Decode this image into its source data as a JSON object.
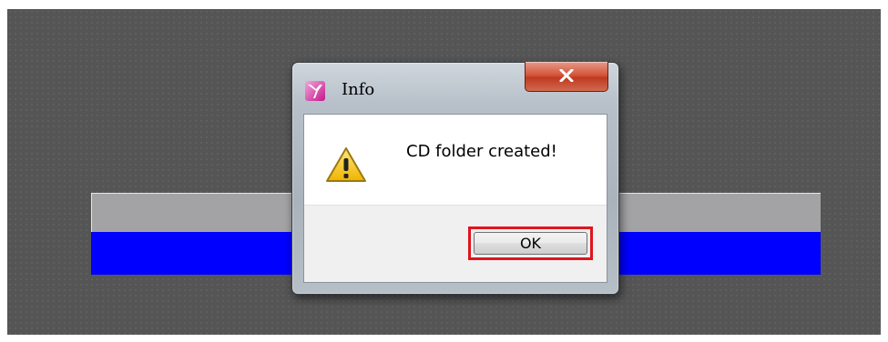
{
  "dialog": {
    "title": "Info",
    "title_icon": "app-logo-icon",
    "close_icon": "close-icon",
    "message_icon": "warning-icon",
    "message": "CD folder created!",
    "ok_label": "OK"
  },
  "colors": {
    "background_panel_gray": "#a3a3a6",
    "background_panel_blue": "#0000ff",
    "close_button": "#c8452b",
    "highlight_box": "#e0141e"
  }
}
